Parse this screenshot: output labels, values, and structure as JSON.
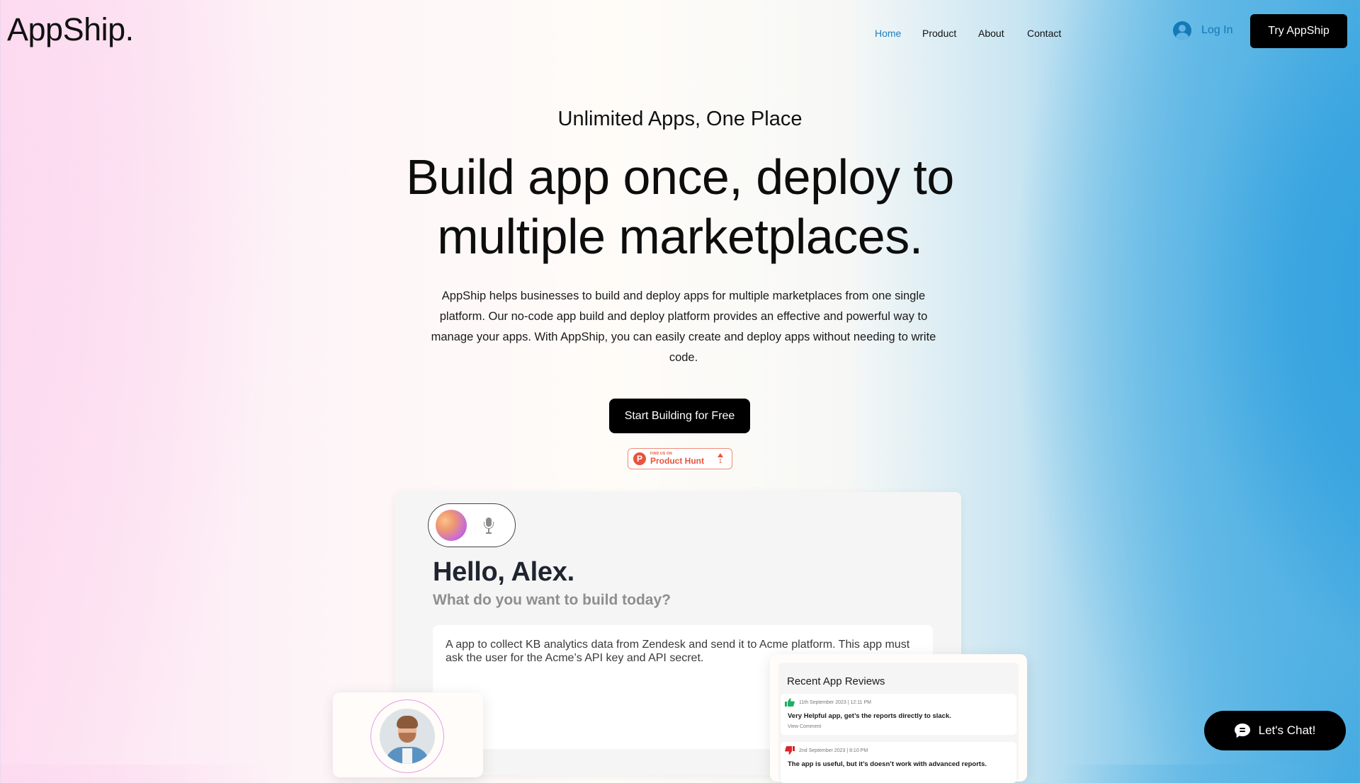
{
  "header": {
    "logo": "AppShip.",
    "nav": [
      {
        "label": "Home",
        "active": true
      },
      {
        "label": "Product",
        "active": false
      },
      {
        "label": "About",
        "active": false
      },
      {
        "label": "Contact",
        "active": false
      }
    ],
    "login_label": "Log In",
    "try_label": "Try AppShip"
  },
  "hero": {
    "tagline": "Unlimited Apps, One Place",
    "headline": "Build app once, deploy to multiple marketplaces.",
    "description": "AppShip helps businesses to build and deploy apps for multiple marketplaces from one single platform. Our no-code app build and deploy platform provides an effective and powerful way to manage your apps. With AppShip, you can easily create and deploy apps without needing to write code.",
    "cta_label": "Start Building for Free",
    "product_hunt": {
      "small": "FIND US ON",
      "big": "Product Hunt",
      "votes": "1"
    }
  },
  "app_preview": {
    "greeting": "Hello, Alex.",
    "question": "What do you want to build today?",
    "prompt": "A app to collect KB analytics data from Zendesk and send it to Acme platform. This app must ask the user for the Acme’s API key and API secret."
  },
  "reviews": {
    "title": "Recent App Reviews",
    "items": [
      {
        "sentiment": "positive",
        "date": "11th September 2023 | 12:11 PM",
        "text": "Very Helpful app, get’s the reports directly to slack.",
        "link": "View Comment"
      },
      {
        "sentiment": "negative",
        "date": "2nd September 2023 | 8:10 PM",
        "text": "The app is useful, but it’s doesn’t work with advanced reports."
      }
    ]
  },
  "chat": {
    "label": "Let's Chat!"
  },
  "colors": {
    "accent_blue": "#1b7fbd",
    "button_black": "#000000",
    "product_hunt": "#e8543d",
    "thumb_up": "#1fae63",
    "thumb_down": "#d9262b"
  }
}
